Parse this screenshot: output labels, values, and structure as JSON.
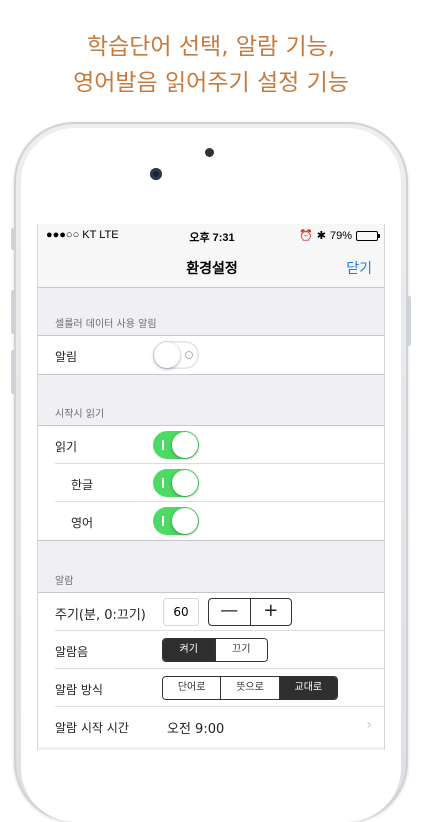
{
  "promo": {
    "line1": "학습단어 선택, 알람 기능,",
    "line2": "영어발음 읽어주기 설정 기능"
  },
  "status_bar": {
    "carrier": "●●●○○ KT  LTE",
    "time": "오후 7:31",
    "alarm_icon": "⏰",
    "bluetooth_icon": "✱",
    "battery_percent": "79%",
    "battery_level": 0.79
  },
  "navbar": {
    "title": "환경설정",
    "close_label": "닫기"
  },
  "sections": {
    "cellular": {
      "header": "셀룰러 데이터 사용 알림",
      "alarm_label": "알림",
      "alarm_on": false
    },
    "startup": {
      "header": "시작시 읽기",
      "read_label": "읽기",
      "korean_label": "한글",
      "english_label": "영어"
    },
    "alarm": {
      "header": "알람",
      "period_label": "주기(분, 0:끄기)",
      "period_value": "60",
      "minus": "—",
      "plus": "+",
      "sound_label": "알람음",
      "sound_options": [
        "켜기",
        "끄기"
      ],
      "sound_selected": "켜기",
      "method_label": "알람 방식",
      "method_options": [
        "단어로",
        "뜻으로",
        "교대로"
      ],
      "method_selected": "교대로",
      "start_time_label": "알람 시작 시간",
      "start_time_value": "오전 9:00",
      "chevron": "›"
    }
  },
  "colors": {
    "promo_text": "#c87a3c",
    "switch_on": "#4cd964",
    "nav_link": "#1a7cf5"
  }
}
